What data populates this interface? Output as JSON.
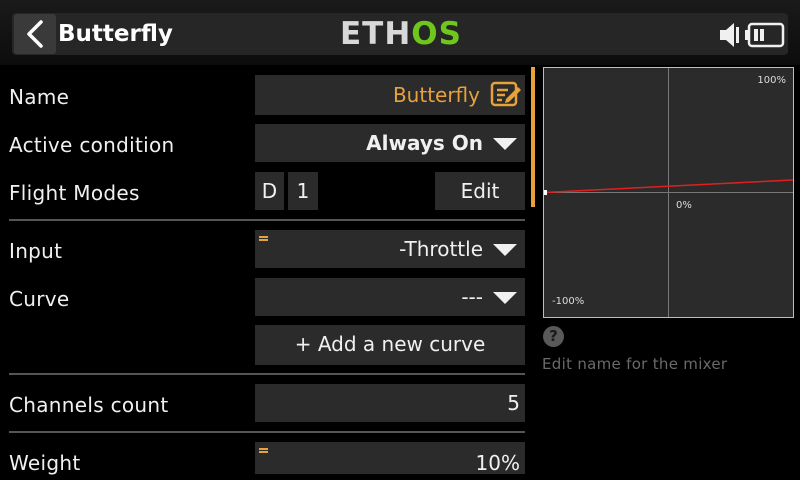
{
  "header": {
    "title": "Butterfly",
    "logo_left": "ETH",
    "logo_right": "OS"
  },
  "form": {
    "name": {
      "label": "Name",
      "value": "Butterfly"
    },
    "active_condition": {
      "label": "Active condition",
      "value": "Always On"
    },
    "flight_modes": {
      "label": "Flight Modes",
      "modes": [
        "D",
        "1"
      ],
      "edit_label": "Edit"
    },
    "input": {
      "label": "Input",
      "value": "-Throttle"
    },
    "curve": {
      "label": "Curve",
      "value": "---",
      "add_label": "+ Add a new curve"
    },
    "channels_count": {
      "label": "Channels count",
      "value": "5"
    },
    "weight": {
      "label": "Weight",
      "value": "10%"
    }
  },
  "graph": {
    "top_label": "100%",
    "center_label": "0%",
    "bottom_label": "-100%",
    "line_color": "#e02020"
  },
  "help": {
    "icon": "?",
    "text": "Edit name for the mixer"
  },
  "colors": {
    "accent": "#e8a23a",
    "logo_green": "#6fc71e"
  }
}
